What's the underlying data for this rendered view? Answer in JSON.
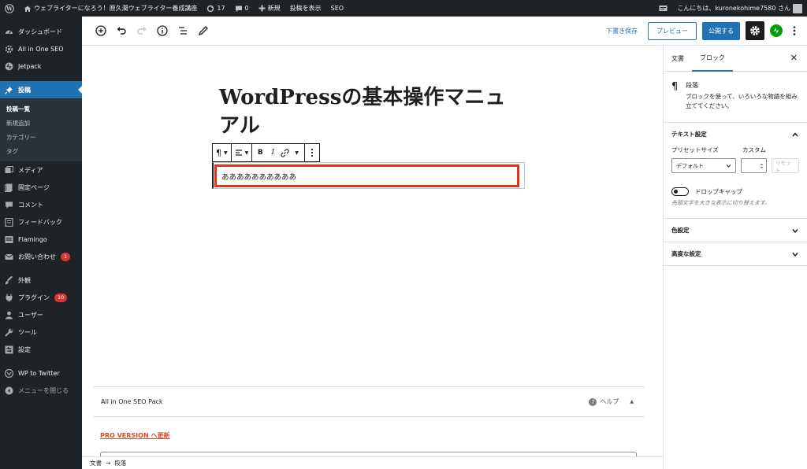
{
  "adminbar": {
    "site_name": "ウェブライターになろう！原久潤ウェブライター養成講座",
    "updates_count": "17",
    "comments_count": "0",
    "new_label": "新規",
    "view_post_label": "投稿を表示",
    "seo_label": "SEO",
    "greeting": "こんにちは、kuronekohime7580 さん"
  },
  "sidebar": {
    "items": [
      {
        "label": "ダッシュボード",
        "icon": "dashboard-icon"
      },
      {
        "label": "All in One SEO",
        "icon": "gear-icon"
      },
      {
        "label": "Jetpack",
        "icon": "jetpack-icon"
      },
      {
        "label": "投稿",
        "icon": "pin-icon"
      },
      {
        "label": "メディア",
        "icon": "media-icon"
      },
      {
        "label": "固定ページ",
        "icon": "page-icon"
      },
      {
        "label": "コメント",
        "icon": "comment-icon"
      },
      {
        "label": "フィードバック",
        "icon": "feedback-icon"
      },
      {
        "label": "Flamingo",
        "icon": "flamingo-icon"
      },
      {
        "label": "お問い合わせ",
        "icon": "mail-icon",
        "badge": "1"
      },
      {
        "label": "外観",
        "icon": "brush-icon"
      },
      {
        "label": "プラグイン",
        "icon": "plugin-icon",
        "badge": "10"
      },
      {
        "label": "ユーザー",
        "icon": "user-icon"
      },
      {
        "label": "ツール",
        "icon": "wrench-icon"
      },
      {
        "label": "設定",
        "icon": "settings-icon"
      },
      {
        "label": "WP to Twitter",
        "icon": "twitter-icon"
      },
      {
        "label": "メニューを閉じる",
        "icon": "collapse-icon"
      }
    ],
    "submenu": [
      "投稿一覧",
      "新規追加",
      "カテゴリー",
      "タグ"
    ]
  },
  "toolbar": {
    "save_draft": "下書き保存",
    "preview": "プレビュー",
    "publish": "公開する"
  },
  "editor": {
    "title": "WordPressの基本操作マニュアル",
    "paragraph_text": "ああああああああああ"
  },
  "metabox": {
    "title": "All in One SEO Pack",
    "help": "ヘルプ",
    "pro_link": "PRO VERSION へ更新"
  },
  "footer": {
    "crumb_document": "文書",
    "crumb_arrow": "→",
    "crumb_block": "段落"
  },
  "settings": {
    "tab_document": "文書",
    "tab_block": "ブロック",
    "block_name": "段落",
    "block_desc": "ブロックを使って、いろいろな物語を組み立ててください。",
    "text_settings": "テキスト設定",
    "preset_size_label": "プリセットサイズ",
    "custom_label": "カスタム",
    "preset_value": "デフォルト",
    "reset": "リセット",
    "drop_cap": "ドロップキャップ",
    "drop_cap_help": "先頭文字を大きな表示に切り替えます。",
    "color_settings": "色設定",
    "advanced_settings": "高度な設定"
  },
  "colors": {
    "admin_dark": "#1d2327",
    "accent_blue": "#2271b1",
    "highlight_red": "#e0311b",
    "badge_red": "#d63638",
    "jetpack_green": "#069e08"
  }
}
